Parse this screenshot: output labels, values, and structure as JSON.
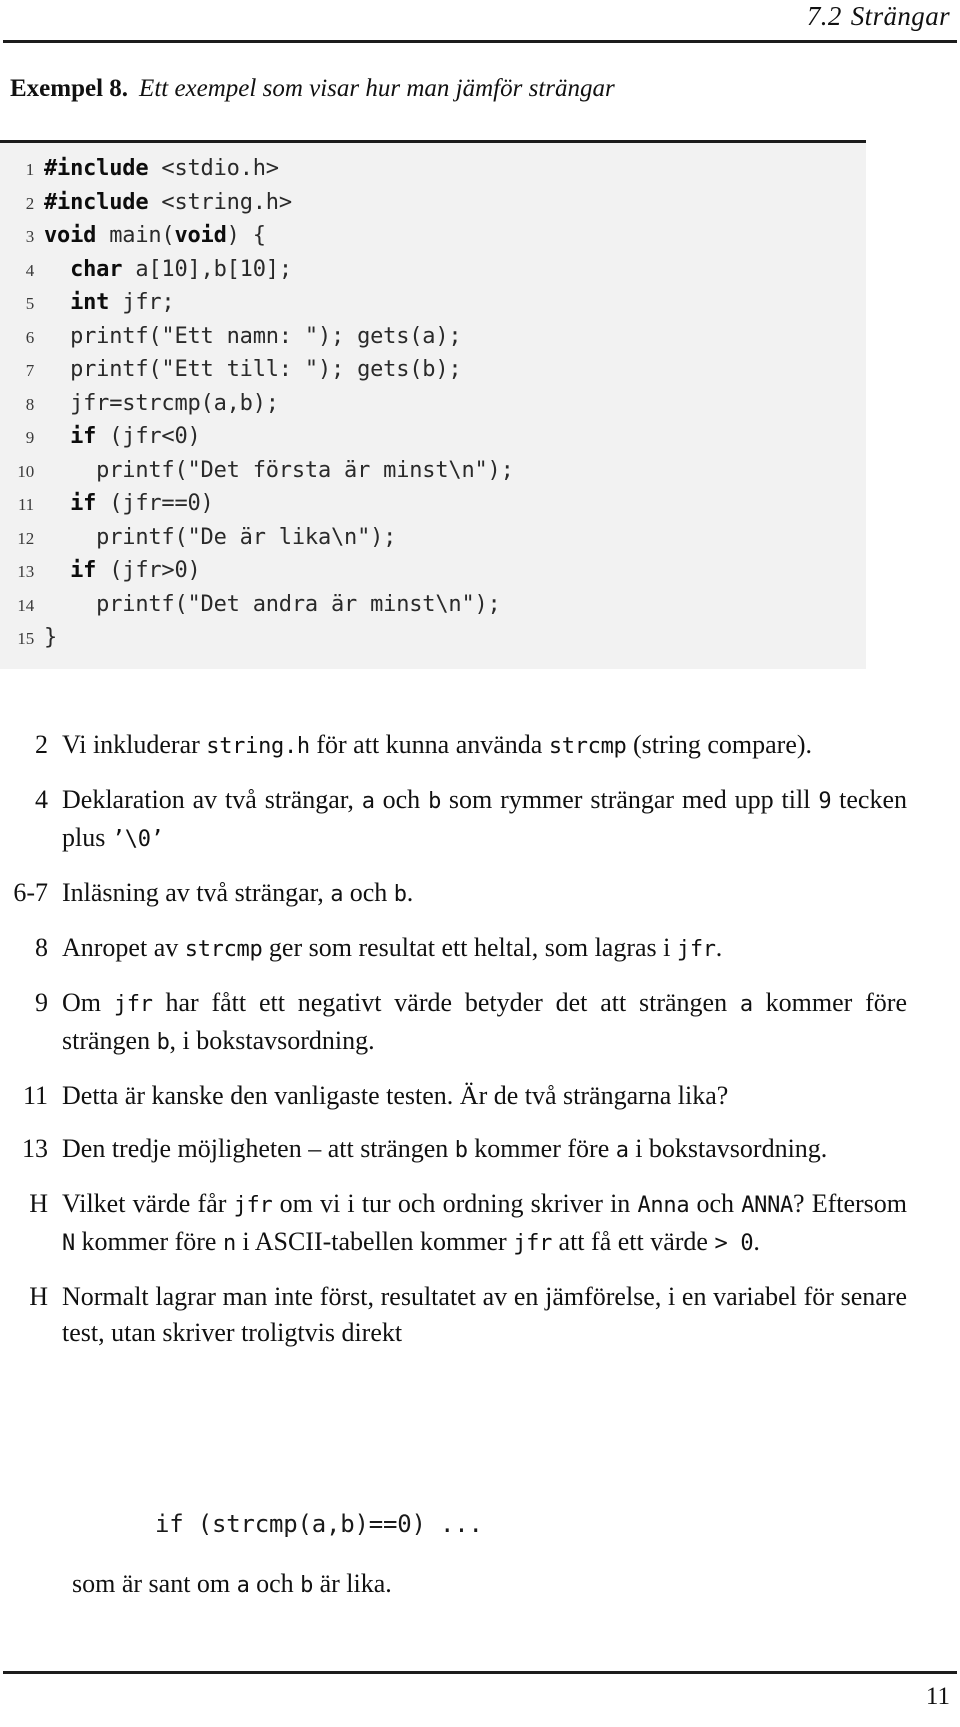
{
  "header": {
    "section_number": "7.2",
    "section_title": "Strängar"
  },
  "example": {
    "label": "Exempel 8.",
    "title": "Ett exempel som visar hur man jämför strängar"
  },
  "code": {
    "lines": [
      {
        "n": "1",
        "segments": [
          {
            "t": "#include",
            "bold": true
          },
          {
            "t": " <stdio.h>",
            "bold": false
          }
        ]
      },
      {
        "n": "2",
        "segments": [
          {
            "t": "#include",
            "bold": true
          },
          {
            "t": " <string.h>",
            "bold": false
          }
        ]
      },
      {
        "n": "3",
        "segments": [
          {
            "t": "void",
            "bold": true
          },
          {
            "t": " main(",
            "bold": false
          },
          {
            "t": "void",
            "bold": true
          },
          {
            "t": ") {",
            "bold": false
          }
        ]
      },
      {
        "n": "4",
        "segments": [
          {
            "t": "  ",
            "bold": false
          },
          {
            "t": "char",
            "bold": true
          },
          {
            "t": " a[10],b[10];",
            "bold": false
          }
        ]
      },
      {
        "n": "5",
        "segments": [
          {
            "t": "  ",
            "bold": false
          },
          {
            "t": "int",
            "bold": true
          },
          {
            "t": " jfr;",
            "bold": false
          }
        ]
      },
      {
        "n": "6",
        "segments": [
          {
            "t": "  printf(\"Ett namn: \"); gets(a);",
            "bold": false
          }
        ]
      },
      {
        "n": "7",
        "segments": [
          {
            "t": "  printf(\"Ett till: \"); gets(b);",
            "bold": false
          }
        ]
      },
      {
        "n": "8",
        "segments": [
          {
            "t": "  jfr=strcmp(a,b);",
            "bold": false
          }
        ]
      },
      {
        "n": "9",
        "segments": [
          {
            "t": "  ",
            "bold": false
          },
          {
            "t": "if",
            "bold": true
          },
          {
            "t": " (jfr<0)",
            "bold": false
          }
        ]
      },
      {
        "n": "10",
        "segments": [
          {
            "t": "    printf(\"Det första är minst\\n\");",
            "bold": false
          }
        ]
      },
      {
        "n": "11",
        "segments": [
          {
            "t": "  ",
            "bold": false
          },
          {
            "t": "if",
            "bold": true
          },
          {
            "t": " (jfr==0)",
            "bold": false
          }
        ]
      },
      {
        "n": "12",
        "segments": [
          {
            "t": "    printf(\"De är lika\\n\");",
            "bold": false
          }
        ]
      },
      {
        "n": "13",
        "segments": [
          {
            "t": "  ",
            "bold": false
          },
          {
            "t": "if",
            "bold": true
          },
          {
            "t": " (jfr>0)",
            "bold": false
          }
        ]
      },
      {
        "n": "14",
        "segments": [
          {
            "t": "    printf(\"Det andra är minst\\n\");",
            "bold": false
          }
        ]
      },
      {
        "n": "15",
        "segments": [
          {
            "t": "}",
            "bold": false
          }
        ]
      }
    ]
  },
  "explanations": [
    {
      "label": "2",
      "parts": [
        {
          "t": "Vi inkluderar ",
          "mono": false
        },
        {
          "t": "string.h",
          "mono": true
        },
        {
          "t": " för att kunna använda ",
          "mono": false
        },
        {
          "t": "strcmp",
          "mono": true
        },
        {
          "t": " (string compare).",
          "mono": false
        }
      ]
    },
    {
      "label": "4",
      "parts": [
        {
          "t": "Deklaration av två strängar, ",
          "mono": false
        },
        {
          "t": "a",
          "mono": true
        },
        {
          "t": " och ",
          "mono": false
        },
        {
          "t": "b",
          "mono": true
        },
        {
          "t": " som rymmer strängar med upp till ",
          "mono": false
        },
        {
          "t": "9",
          "mono": true
        },
        {
          "t": " tecken plus ",
          "mono": false
        },
        {
          "t": "’\\0’",
          "mono": true
        }
      ]
    },
    {
      "label": "6-7",
      "parts": [
        {
          "t": "Inläsning av två strängar, ",
          "mono": false
        },
        {
          "t": "a",
          "mono": true
        },
        {
          "t": " och ",
          "mono": false
        },
        {
          "t": "b",
          "mono": true
        },
        {
          "t": ".",
          "mono": false
        }
      ]
    },
    {
      "label": "8",
      "parts": [
        {
          "t": "Anropet av ",
          "mono": false
        },
        {
          "t": "strcmp",
          "mono": true
        },
        {
          "t": " ger som resultat ett heltal, som lagras i ",
          "mono": false
        },
        {
          "t": "jfr",
          "mono": true
        },
        {
          "t": ".",
          "mono": false
        }
      ]
    },
    {
      "label": "9",
      "parts": [
        {
          "t": "Om ",
          "mono": false
        },
        {
          "t": "jfr",
          "mono": true
        },
        {
          "t": " har fått ett negativt värde betyder det att strängen ",
          "mono": false
        },
        {
          "t": "a",
          "mono": true
        },
        {
          "t": " kommer före strängen ",
          "mono": false
        },
        {
          "t": "b",
          "mono": true
        },
        {
          "t": ", i bokstavsordning.",
          "mono": false
        }
      ]
    },
    {
      "label": "11",
      "parts": [
        {
          "t": "Detta är kanske den vanligaste testen. Är de två strängarna lika?",
          "mono": false
        }
      ]
    },
    {
      "label": "13",
      "parts": [
        {
          "t": "Den tredje möjligheten – att strängen ",
          "mono": false
        },
        {
          "t": "b",
          "mono": true
        },
        {
          "t": " kommer före ",
          "mono": false
        },
        {
          "t": "a",
          "mono": true
        },
        {
          "t": " i bokstavsordning.",
          "mono": false
        }
      ]
    },
    {
      "label": "H",
      "parts": [
        {
          "t": "Vilket värde får ",
          "mono": false
        },
        {
          "t": "jfr",
          "mono": true
        },
        {
          "t": " om vi i tur och ordning skriver in ",
          "mono": false
        },
        {
          "t": "Anna",
          "mono": true
        },
        {
          "t": " och ",
          "mono": false
        },
        {
          "t": "ANNA",
          "mono": true
        },
        {
          "t": "? Eftersom ",
          "mono": false
        },
        {
          "t": "N",
          "mono": true
        },
        {
          "t": " kommer före ",
          "mono": false
        },
        {
          "t": "n",
          "mono": true
        },
        {
          "t": " i ASCII-tabellen kommer ",
          "mono": false
        },
        {
          "t": "jfr",
          "mono": true
        },
        {
          "t": " att få ett värde ",
          "mono": false
        },
        {
          "t": "> 0",
          "mono": true
        },
        {
          "t": ".",
          "mono": false
        }
      ]
    },
    {
      "label": "H",
      "parts": [
        {
          "t": "Normalt lagrar man inte först, resultatet av en jämförelse, i en variabel för senare test, utan skriver troligtvis direkt",
          "mono": false
        }
      ]
    }
  ],
  "trailing_snippet": "if (strcmp(a,b)==0) ...",
  "closing_line": {
    "parts": [
      {
        "t": "som är sant om ",
        "mono": false
      },
      {
        "t": "a",
        "mono": true
      },
      {
        "t": " och ",
        "mono": false
      },
      {
        "t": "b",
        "mono": true
      },
      {
        "t": " är lika.",
        "mono": false
      }
    ]
  },
  "footer": {
    "page_number": "11"
  }
}
